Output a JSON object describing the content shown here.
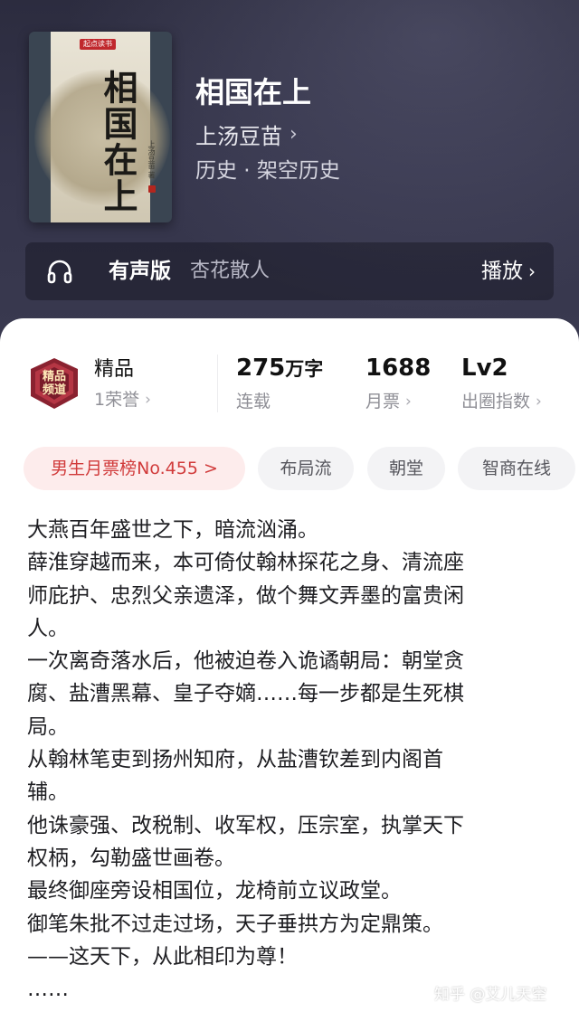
{
  "book": {
    "cover_logo": "起点读书",
    "cover_title": "相国在上",
    "cover_author": "上汤豆苗 著",
    "title": "相国在上",
    "author": "上汤豆苗",
    "genre": "历史 · 架空历史"
  },
  "audio": {
    "icon": "headphones-icon",
    "label": "有声版",
    "narrator": "杏花散人",
    "play_label": "播放"
  },
  "stats": {
    "badge_line1": "精品",
    "badge_line2": "频道",
    "quality_label": "精品",
    "honor": "1荣誉",
    "word_count": "275",
    "word_unit": "万字",
    "status": "连载",
    "monthly_tickets": "1688",
    "monthly_tickets_label": "月票",
    "level": "Lv2",
    "level_label": "出圈指数"
  },
  "tags": [
    "男生月票榜No.455 >",
    "布局流",
    "朝堂",
    "智商在线"
  ],
  "description": [
    "大燕百年盛世之下，暗流汹涌。",
    "薛淮穿越而来，本可倚仗翰林探花之身、清流座",
    "师庇护、忠烈父亲遗泽，做个舞文弄墨的富贵闲",
    "人。",
    "一次离奇落水后，他被迫卷入诡谲朝局：朝堂贪",
    "腐、盐漕黑幕、皇子夺嫡……每一步都是生死棋",
    "局。",
    "从翰林笔吏到扬州知府，从盐漕钦差到内阁首",
    "辅。",
    "他诛豪强、改税制、收军权，压宗室，执掌天下",
    "权柄，勾勒盛世画卷。",
    "最终御座旁设相国位，龙椅前立议政堂。",
    "御笔朱批不过走过场，天子垂拱方为定鼎策。",
    "——这天下，从此相印为尊！",
    "……"
  ],
  "watermark": "知乎 @艾儿天空",
  "colors": {
    "hero_bg": "#34344a",
    "hot_tag_bg": "#fdecec",
    "hot_tag_text": "#d13b3b"
  }
}
